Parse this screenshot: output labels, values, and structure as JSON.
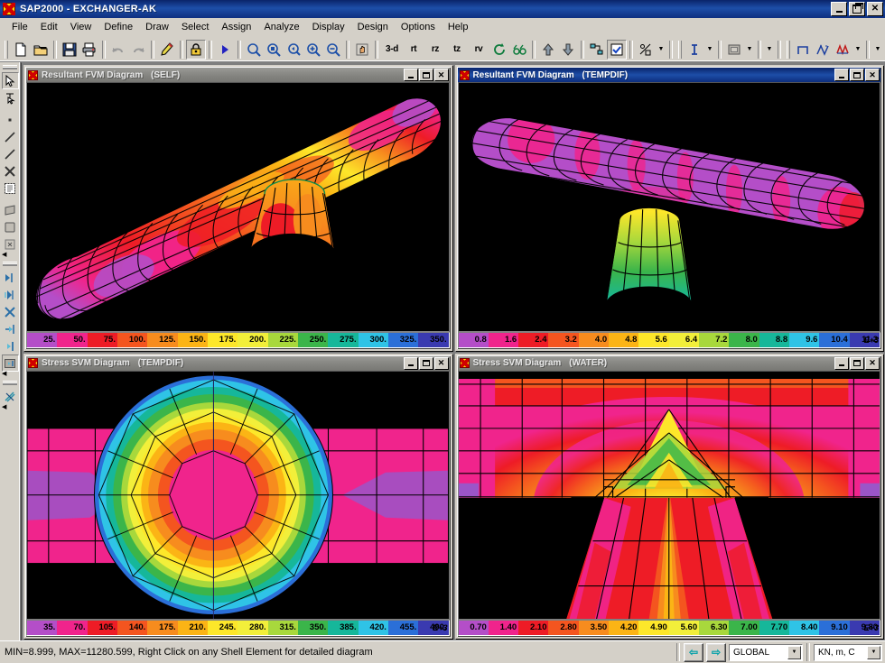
{
  "window": {
    "title": "SAP2000 - EXCHANGER-AK",
    "logo_icon": "sap2000-logo-icon",
    "controls": [
      {
        "name": "minimize",
        "label": "_"
      },
      {
        "name": "restore",
        "label": "❐"
      },
      {
        "name": "close",
        "label": "✕"
      }
    ]
  },
  "menu": {
    "items": [
      {
        "label": "File",
        "accel": "F"
      },
      {
        "label": "Edit",
        "accel": "E"
      },
      {
        "label": "View",
        "accel": "V"
      },
      {
        "label": "Define",
        "accel": "D"
      },
      {
        "label": "Draw",
        "accel": "r"
      },
      {
        "label": "Select",
        "accel": "S"
      },
      {
        "label": "Assign",
        "accel": "A"
      },
      {
        "label": "Analyze",
        "accel": "n"
      },
      {
        "label": "Display",
        "accel": "i"
      },
      {
        "label": "Design",
        "accel": "g"
      },
      {
        "label": "Options",
        "accel": "O"
      },
      {
        "label": "Help",
        "accel": "H"
      }
    ]
  },
  "toolbar": {
    "groups": [
      [
        "new-file-icon",
        "open-file-icon"
      ],
      [
        "save-icon",
        "print-icon"
      ],
      [
        "undo-icon",
        "redo-icon"
      ],
      [
        "edit-pencil-icon"
      ],
      [
        "lock-icon"
      ],
      [
        "run-analysis-icon"
      ],
      [
        "zoom-window-icon",
        "zoom-full-icon",
        "zoom-previous-icon",
        "zoom-in-icon",
        "zoom-out-icon"
      ],
      [
        "pan-icon"
      ],
      [
        "view-3d-icon",
        "view-rt-icon",
        "view-rz-icon",
        "view-tz-icon",
        "view-rv-icon",
        "rotate-3d-icon",
        "perspective-icon"
      ],
      [
        "move-up-icon",
        "move-down-icon"
      ],
      [
        "assign-object-icon",
        "select-all-icon"
      ],
      [
        "percent-scale-icon"
      ],
      [
        "text-label-icon"
      ],
      [
        "shell-display-icon"
      ],
      [
        "moment-diagram-icon",
        "shear-diagram-icon",
        "axial-diagram-icon"
      ]
    ],
    "view_labels": {
      "v3d": "3-d",
      "rt": "rt",
      "rz": "rz",
      "tz": "tz",
      "rv": "rv"
    }
  },
  "side_toolbar": {
    "top_items": [
      "pointer-select-icon",
      "reshape-element-icon",
      "draw-point-icon",
      "draw-frame-icon",
      "draw-line-icon",
      "draw-special-joint-icon",
      "draw-rectangular-area-icon",
      "draw-quad-area-icon",
      "draw-area-icon",
      "draw-section-cut-icon"
    ],
    "mid_items": [
      "select-all-icon",
      "select-previous-icon",
      "clear-selection-icon",
      "deselect-icon"
    ],
    "snap_items": [
      "snap-point-icon",
      "snap-midpoint-icon",
      "snap-intersection-icon",
      "snap-perpendicular-icon",
      "snap-line-end-icon",
      "snap-grid-icon"
    ]
  },
  "windows": [
    {
      "id": "win-self",
      "title": "Resultant FVM Diagram",
      "case": "(SELF)",
      "active": false,
      "view": "isometric-pipe-nozzle",
      "legend": {
        "labels": [
          "25.",
          "50.",
          "75.",
          "100.",
          "125.",
          "150.",
          "175.",
          "200.",
          "225.",
          "250.",
          "275.",
          "300.",
          "325.",
          "350."
        ],
        "exponent": "",
        "colors": [
          "#b44ec8",
          "#f0248c",
          "#ee1c26",
          "#f4551f",
          "#f78c1e",
          "#fbb415",
          "#fde72a",
          "#f2ef3a",
          "#a8d83c",
          "#3bb54a",
          "#16b79a",
          "#2fc3e6",
          "#2b6fd8",
          "#3a3ab0"
        ]
      }
    },
    {
      "id": "win-tempdif-fvm",
      "title": "Resultant FVM Diagram",
      "case": "(TEMPDIF)",
      "active": true,
      "view": "isometric-pipe-nozzle-purple",
      "legend": {
        "labels": [
          "0.8",
          "1.6",
          "2.4",
          "3.2",
          "4.0",
          "4.8",
          "5.6",
          "6.4",
          "7.2",
          "8.0",
          "8.8",
          "9.6",
          "10.4",
          "11.2"
        ],
        "exponent": "E+3",
        "colors": [
          "#b44ec8",
          "#f0248c",
          "#ee1c26",
          "#f4551f",
          "#f78c1e",
          "#fbb415",
          "#fde72a",
          "#f2ef3a",
          "#a8d83c",
          "#3bb54a",
          "#16b79a",
          "#2fc3e6",
          "#2b6fd8",
          "#3a3ab0"
        ]
      }
    },
    {
      "id": "win-tempdif-svm",
      "title": "Stress SVM Diagram",
      "case": "(TEMPDIF)",
      "active": false,
      "view": "plan-circular-nozzle",
      "legend": {
        "labels": [
          "35.",
          "70.",
          "105.",
          "140.",
          "175.",
          "210.",
          "245.",
          "280.",
          "315.",
          "350.",
          "385.",
          "420.",
          "455.",
          "490."
        ],
        "exponent": "E+3",
        "colors": [
          "#b44ec8",
          "#f0248c",
          "#ee1c26",
          "#f4551f",
          "#f78c1e",
          "#fbb415",
          "#fde72a",
          "#f2ef3a",
          "#a8d83c",
          "#3bb54a",
          "#16b79a",
          "#2fc3e6",
          "#2b6fd8",
          "#3a3ab0"
        ]
      }
    },
    {
      "id": "win-water-svm",
      "title": "Stress SVM Diagram",
      "case": "(WATER)",
      "active": false,
      "view": "elevation-tee-junction",
      "legend": {
        "labels": [
          "0.70",
          "1.40",
          "2.10",
          "2.80",
          "3.50",
          "4.20",
          "4.90",
          "5.60",
          "6.30",
          "7.00",
          "7.70",
          "8.40",
          "9.10",
          "9.80"
        ],
        "exponent": "E+3",
        "colors": [
          "#b44ec8",
          "#f0248c",
          "#ee1c26",
          "#f4551f",
          "#f78c1e",
          "#fbb415",
          "#fde72a",
          "#f2ef3a",
          "#a8d83c",
          "#3bb54a",
          "#16b79a",
          "#2fc3e6",
          "#2b6fd8",
          "#3a3ab0"
        ]
      }
    }
  ],
  "status": {
    "message": "MIN=8.999, MAX=11280.599, Right Click on any Shell Element for detailed diagram",
    "back_arrow": "⇦",
    "forward_arrow": "⇨",
    "coord_system": "GLOBAL",
    "units": "KN, m, C"
  },
  "colors": {
    "titlebar_active": "#0a246a",
    "titlebar_inactive": "#868682",
    "chrome": "#d4d0c8",
    "mdi_background": "#7f7f7f",
    "canvas_background": "#000000"
  }
}
